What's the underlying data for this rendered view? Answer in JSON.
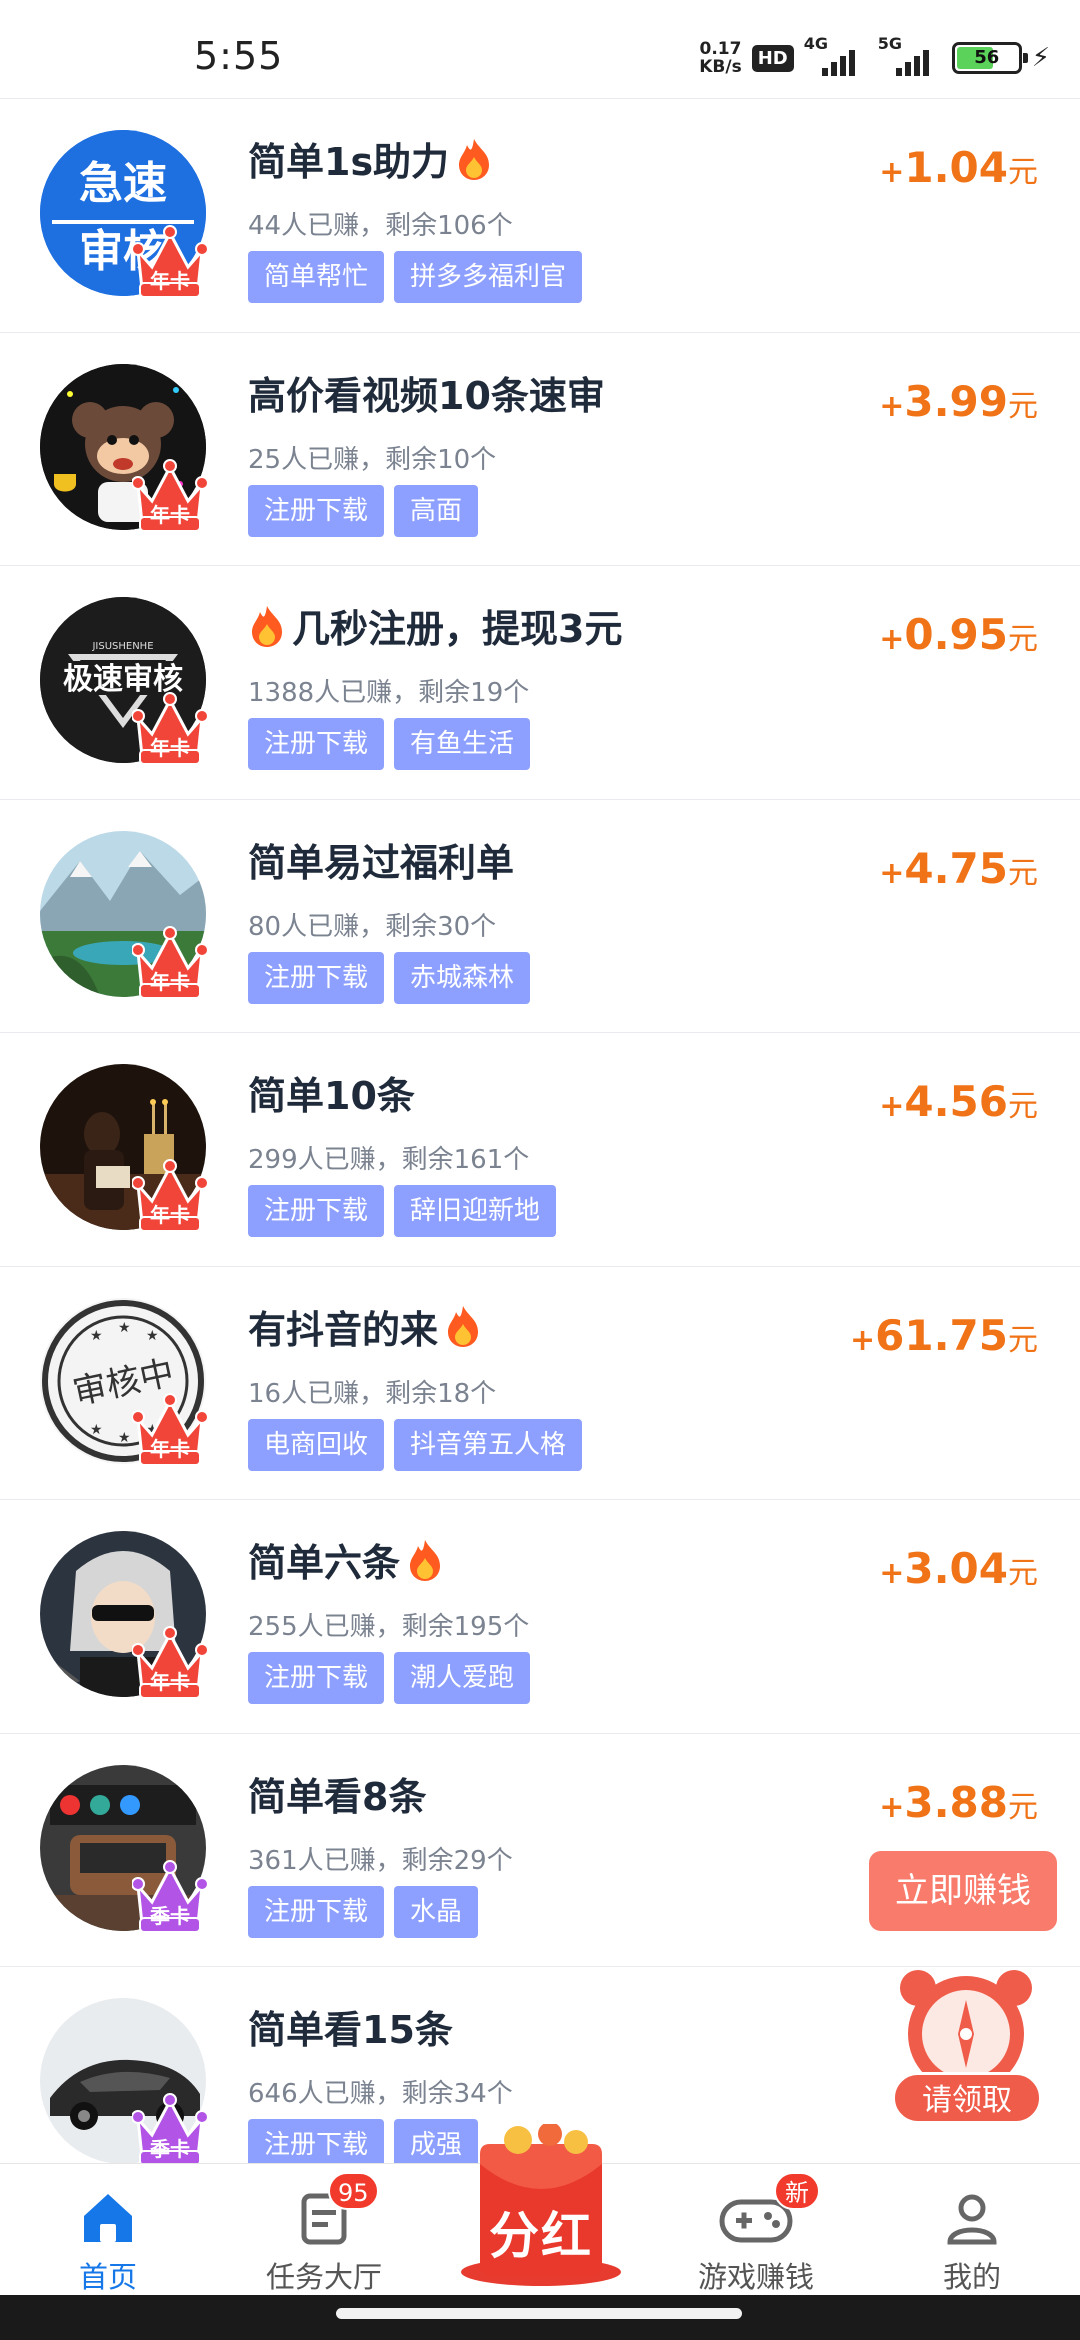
{
  "status_bar": {
    "time": "5:55",
    "speed_value": "0.17",
    "speed_unit": "KB/s",
    "hd_label": "HD",
    "network_1": "4G",
    "network_2": "5G",
    "battery": "56"
  },
  "tasks": [
    {
      "title": "简单1s助力",
      "stats": "44人已赚，剩余106个",
      "tags": [
        "简单帮忙",
        "拼多多福利官"
      ],
      "plus": "+",
      "amount": "1.04",
      "unit": "元",
      "badge": "年卡",
      "avatar_text": [
        "急速",
        "审核"
      ]
    },
    {
      "title": "高价看视频10条速审",
      "stats": "25人已赚，剩余10个",
      "tags": [
        "注册下载",
        "高面"
      ],
      "plus": "+",
      "amount": "3.99",
      "unit": "元",
      "badge": "年卡"
    },
    {
      "title": "几秒注册，提现3元",
      "stats": "1388人已赚，剩余19个",
      "tags": [
        "注册下载",
        "有鱼生活"
      ],
      "plus": "+",
      "amount": "0.95",
      "unit": "元",
      "badge": "年卡",
      "avatar_text": [
        "JISUSHENHE",
        "极速审核"
      ]
    },
    {
      "title": "简单易过福利单",
      "stats": "80人已赚，剩余30个",
      "tags": [
        "注册下载",
        "赤城森林"
      ],
      "plus": "+",
      "amount": "4.75",
      "unit": "元",
      "badge": "年卡"
    },
    {
      "title": "简单10条",
      "stats": "299人已赚，剩余161个",
      "tags": [
        "注册下载",
        "辞旧迎新地"
      ],
      "plus": "+",
      "amount": "4.56",
      "unit": "元",
      "badge": "年卡"
    },
    {
      "title": "有抖音的来",
      "stats": "16人已赚，剩余18个",
      "tags": [
        "电商回收",
        "抖音第五人格"
      ],
      "plus": "+",
      "amount": "61.75",
      "unit": "元",
      "badge": "年卡",
      "avatar_text": [
        "审核中"
      ]
    },
    {
      "title": "简单六条",
      "stats": "255人已赚，剩余195个",
      "tags": [
        "注册下载",
        "潮人爱跑"
      ],
      "plus": "+",
      "amount": "3.04",
      "unit": "元",
      "badge": "年卡"
    },
    {
      "title": "简单看8条",
      "stats": "361人已赚，剩余29个",
      "tags": [
        "注册下载",
        "水晶"
      ],
      "plus": "+",
      "amount": "3.88",
      "unit": "元",
      "badge": "季卡"
    },
    {
      "title": "简单看15条",
      "stats": "646人已赚，剩余34个",
      "tags": [
        "注册下载",
        "成强"
      ],
      "plus": "",
      "amount": "",
      "unit": "",
      "badge": "季卡"
    }
  ],
  "floating": {
    "earn_now": "立即赚钱",
    "claim": "请领取"
  },
  "bottom_nav": {
    "items": [
      {
        "label": "首页",
        "icon": "home-icon",
        "active": true
      },
      {
        "label": "任务大厅",
        "icon": "task-hall-icon",
        "badge": "95"
      },
      {
        "label": "分红",
        "icon": "red-envelope-icon"
      },
      {
        "label": "游戏赚钱",
        "icon": "gamepad-icon",
        "badge": "新"
      },
      {
        "label": "我的",
        "icon": "user-icon"
      }
    ]
  },
  "colors": {
    "accent_blue": "#1677e8",
    "reward_orange": "#f07317",
    "tag_bg": "#8ea0ff",
    "crown_red": "#f2453a",
    "crown_purple": "#b254e6"
  }
}
